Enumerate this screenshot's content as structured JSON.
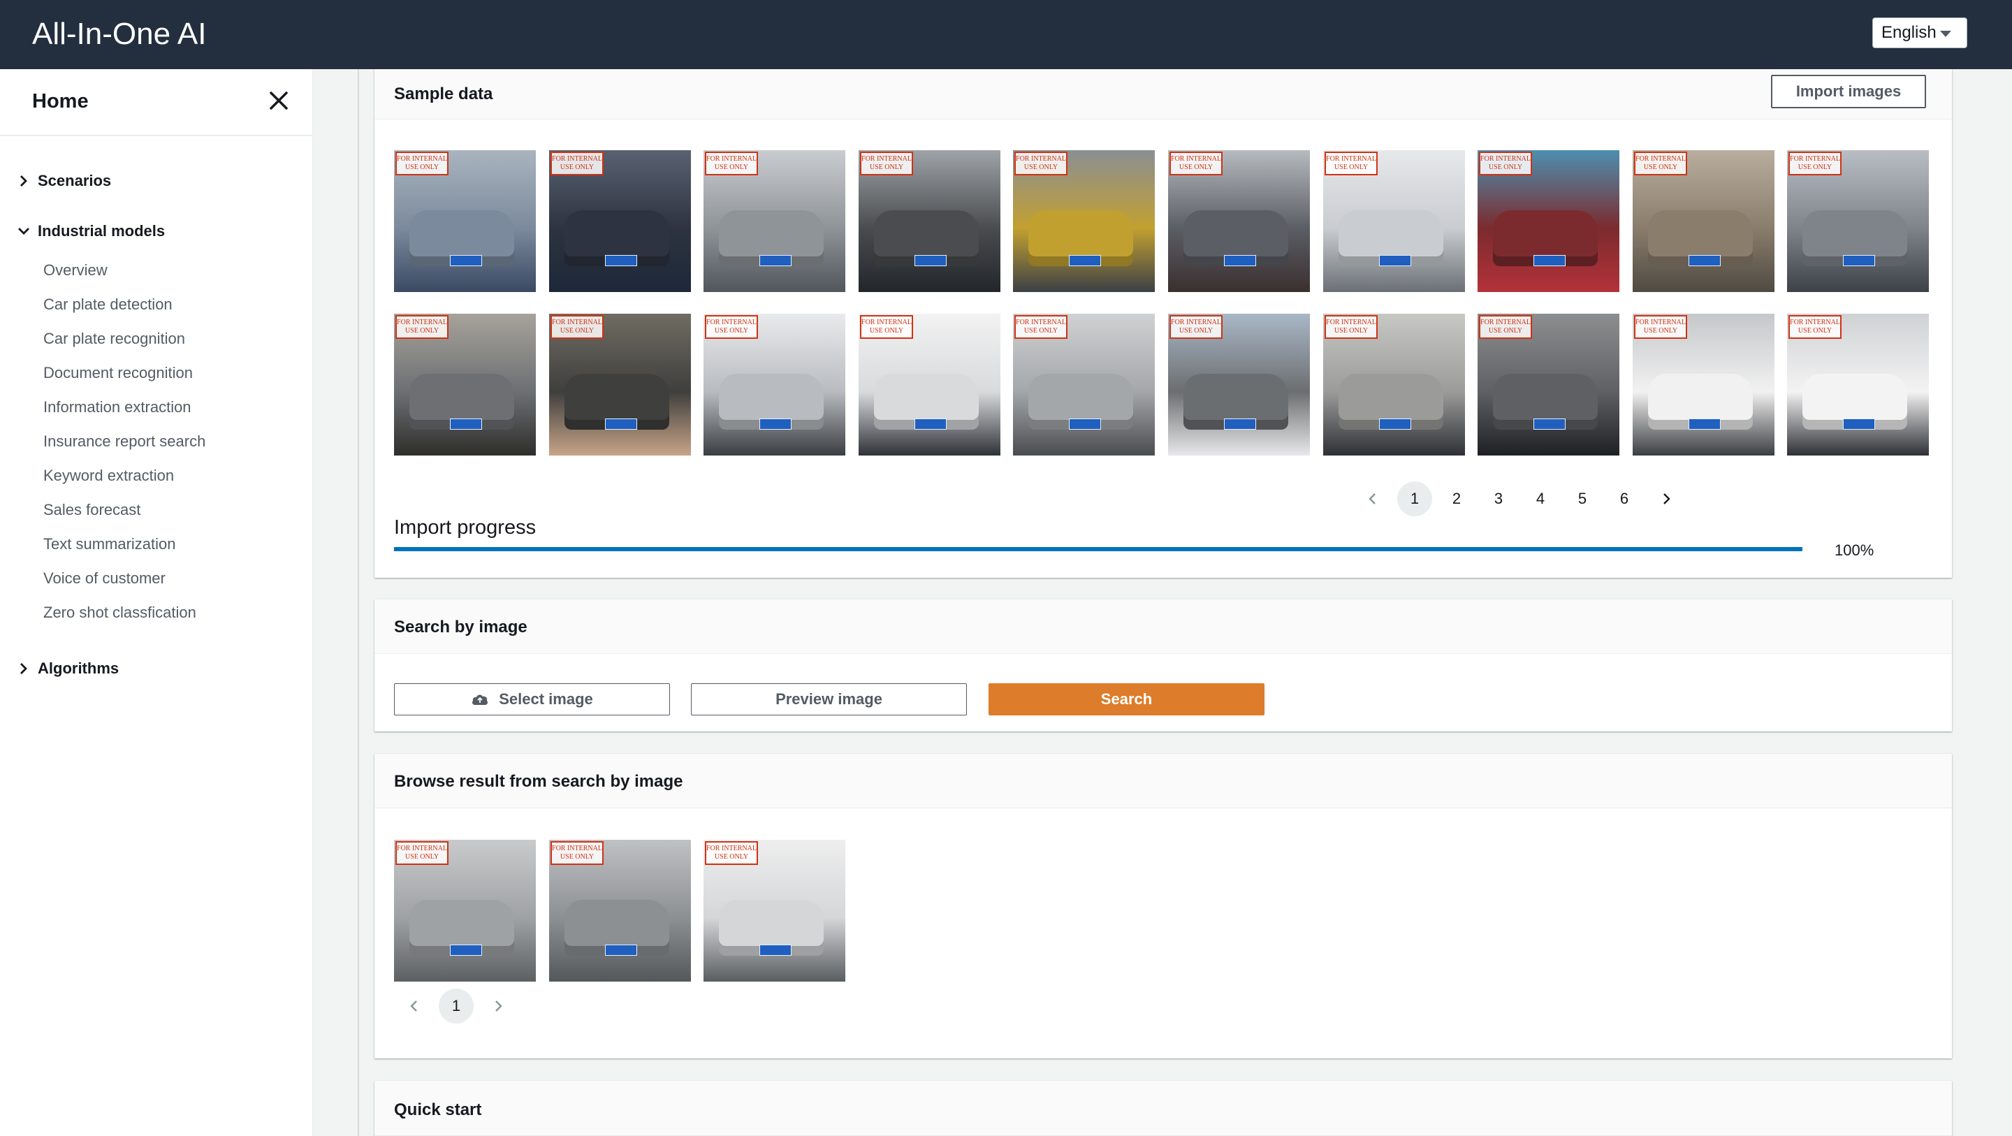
{
  "header": {
    "title": "All-In-One AI",
    "language": "English"
  },
  "sidebar": {
    "home": "Home",
    "sections": {
      "scenarios": "Scenarios",
      "industrial_models": "Industrial models",
      "algorithms": "Algorithms"
    },
    "items": [
      "Overview",
      "Car plate detection",
      "Car plate recognition",
      "Document recognition",
      "Information extraction",
      "Insurance report search",
      "Keyword extraction",
      "Sales forecast",
      "Text summarization",
      "Voice of customer",
      "Zero shot classfication"
    ]
  },
  "sample_data": {
    "title": "Sample data",
    "import_button": "Import images",
    "watermark": "FOR INTERNAL USE ONLY",
    "pages": [
      "1",
      "2",
      "3",
      "4",
      "5",
      "6"
    ],
    "active_page": "1",
    "progress_label": "Import progress",
    "progress_value": "100%",
    "progress_fraction": 1.0
  },
  "search_by_image": {
    "title": "Search by image",
    "select_button": "Select image",
    "preview_button": "Preview image",
    "search_button": "Search"
  },
  "browse_result": {
    "title": "Browse result from search by image",
    "pages": [
      "1"
    ],
    "active_page": "1"
  },
  "quick_start": {
    "title": "Quick start"
  },
  "colors": {
    "header_bg": "#232f3e",
    "primary": "#dd7c2a",
    "progress": "#0073bb",
    "stamp": "#d13212"
  }
}
